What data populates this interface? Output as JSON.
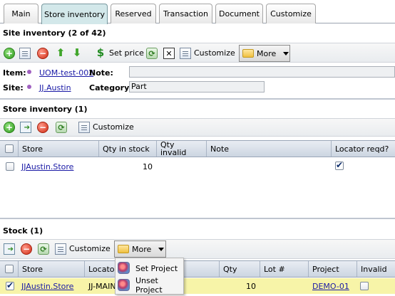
{
  "tabs": [
    {
      "label": "Main"
    },
    {
      "label": "Store inventory"
    },
    {
      "label": "Reserved"
    },
    {
      "label": "Transaction"
    },
    {
      "label": "Document"
    },
    {
      "label": "Customize"
    }
  ],
  "active_tab": "Store inventory",
  "site_inventory": {
    "title": "Site inventory (2 of 42)",
    "toolbar": {
      "set_price": "Set price",
      "customize": "Customize",
      "more": "More"
    },
    "fields": {
      "item_label": "Item:",
      "item_value": "UOM-test-002",
      "note_label": "Note:",
      "note_value": "",
      "site_label": "Site:",
      "site_value": "JJ.Austin",
      "category_label": "Category:",
      "category_value": "Part"
    }
  },
  "store_inventory": {
    "title": "Store inventory (1)",
    "toolbar": {
      "customize": "Customize"
    },
    "columns": [
      "Store",
      "Qty in stock",
      "Qty invalid",
      "Note",
      "Locator reqd?"
    ],
    "rows": [
      {
        "store": "JJAustin.Store",
        "qty_in_stock": "10",
        "qty_invalid": "",
        "note": "",
        "locator_reqd": true
      }
    ]
  },
  "stock": {
    "title": "Stock (1)",
    "toolbar": {
      "customize": "Customize",
      "more": "More"
    },
    "columns": [
      "Store",
      "Locator",
      "Qty",
      "Lot #",
      "Project",
      "Invalid"
    ],
    "rows": [
      {
        "store": "JJAustin.Store",
        "locator": "JJ-MAIN",
        "qty": "10",
        "lot": "",
        "project": "DEMO-01",
        "invalid": false,
        "selected": true
      }
    ],
    "more_menu": [
      {
        "label": "Set Project"
      },
      {
        "label": "Unset Project"
      }
    ]
  },
  "colors": {
    "active_tab": "#d3e8ea",
    "selected_row": "#f7f4a8",
    "link": "#1a1aa6",
    "header": "#ccd5e1"
  },
  "icons": [
    "add-icon",
    "edit-icon",
    "delete-icon",
    "move-up-icon",
    "move-down-icon",
    "set-price-icon",
    "refresh-icon",
    "close-icon",
    "customize-icon",
    "folder-icon",
    "export-icon",
    "project-icon"
  ]
}
